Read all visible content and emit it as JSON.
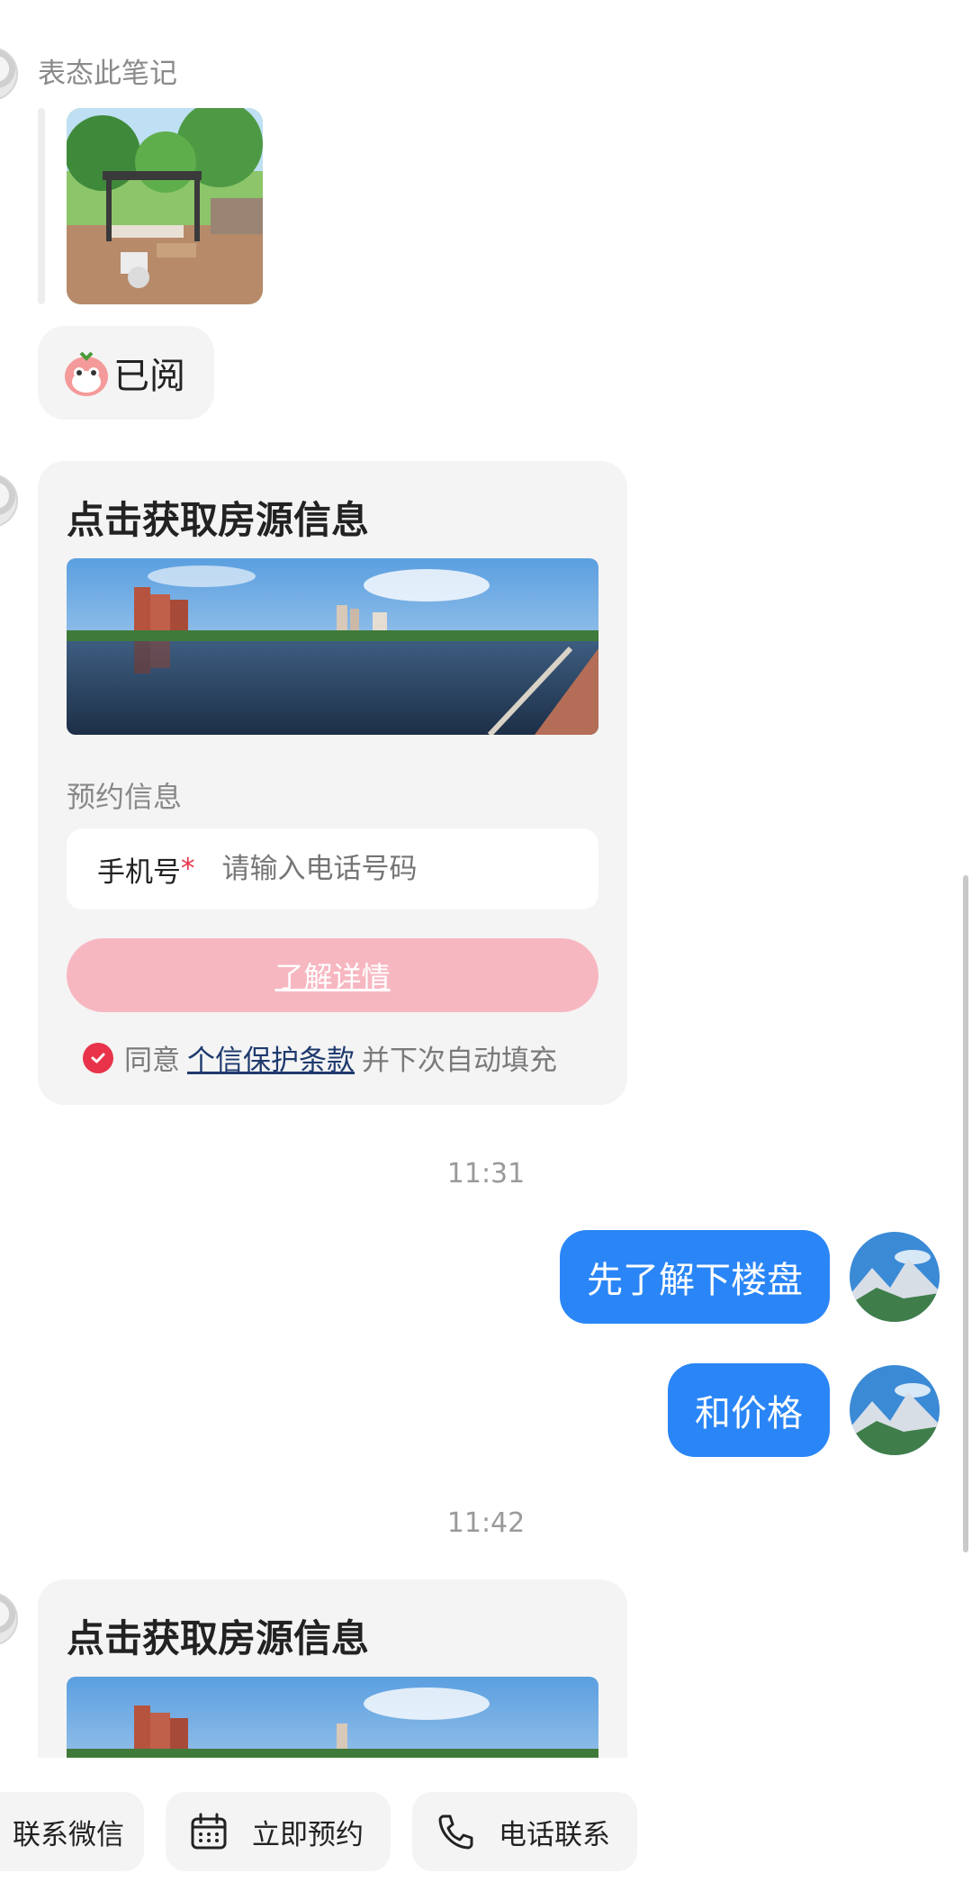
{
  "note": {
    "label": "表态此笔记"
  },
  "read_reply": {
    "text": "已阅"
  },
  "cards": [
    {
      "title": "点击获取房源信息",
      "section_label": "预约信息",
      "phone_label": "手机号",
      "required_mark": "*",
      "phone_placeholder": "请输入电话号码",
      "cta_label": "了解详情",
      "agree_prefix": "同意",
      "agree_link": "个信保护条款",
      "agree_suffix": "并下次自动填充"
    },
    {
      "title": "点击获取房源信息"
    }
  ],
  "timestamps": [
    "11:31",
    "11:42"
  ],
  "messages_out": [
    "先了解下楼盘",
    "和价格"
  ],
  "bottom_actions": [
    {
      "label": "联系微信",
      "icon": "wechat-icon"
    },
    {
      "label": "立即预约",
      "icon": "calendar-icon"
    },
    {
      "label": "电话联系",
      "icon": "phone-icon"
    }
  ],
  "colors": {
    "accent_blue": "#2a86f7",
    "brand_red": "#e8334a",
    "cta_pink": "#f7b7c1",
    "link_navy": "#1e3a6e"
  }
}
